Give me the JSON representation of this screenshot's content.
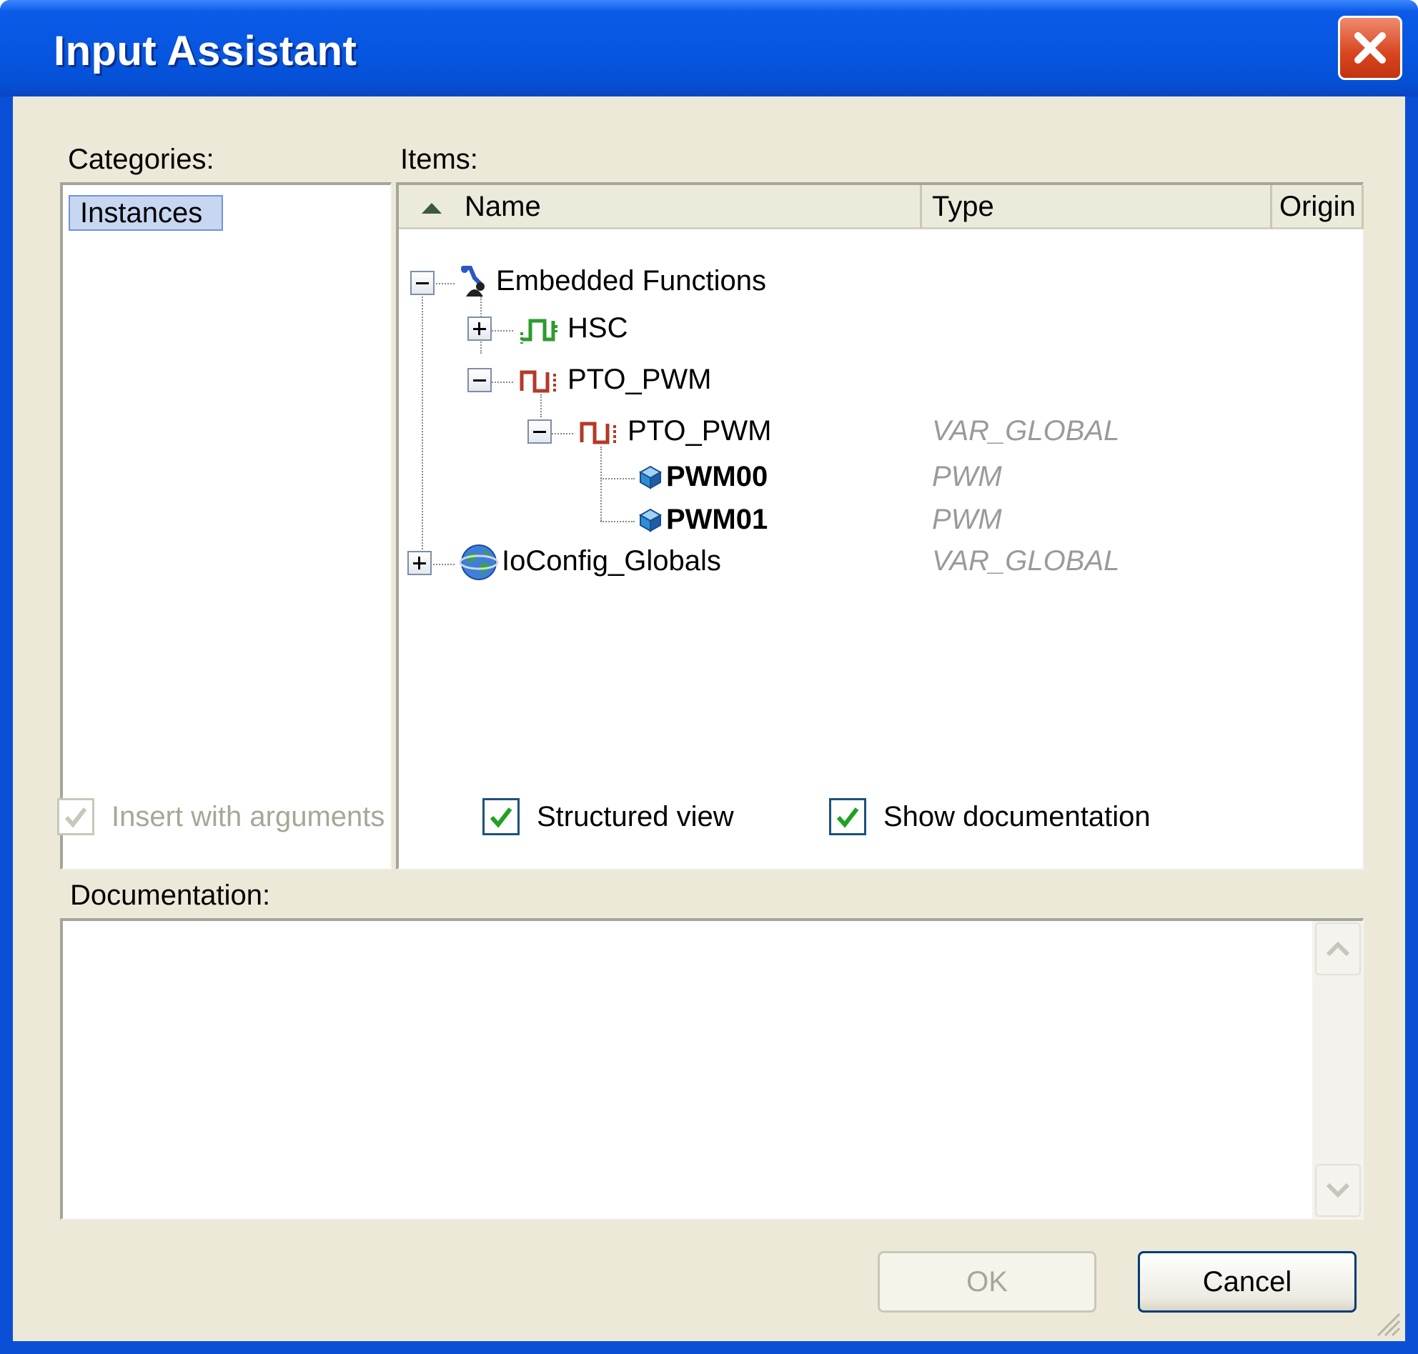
{
  "dialog": {
    "title": "Input Assistant"
  },
  "categories": {
    "label": "Categories:",
    "items": [
      "Instances"
    ]
  },
  "items": {
    "label": "Items:",
    "columns": {
      "name": "Name",
      "type": "Type",
      "origin": "Origin"
    },
    "rows": [
      {
        "name": "Embedded Functions",
        "type": ""
      },
      {
        "name": "HSC",
        "type": ""
      },
      {
        "name": "PTO_PWM",
        "type": ""
      },
      {
        "name": "PTO_PWM",
        "type": "VAR_GLOBAL"
      },
      {
        "name": "PWM00",
        "type": "PWM"
      },
      {
        "name": "PWM01",
        "type": "PWM"
      },
      {
        "name": "IoConfig_Globals",
        "type": "VAR_GLOBAL"
      }
    ]
  },
  "options": {
    "insert_with_arguments": {
      "label": "Insert with arguments",
      "checked": true,
      "enabled": false
    },
    "structured_view": {
      "label": "Structured view",
      "checked": true,
      "enabled": true
    },
    "show_documentation": {
      "label": "Show documentation",
      "checked": true,
      "enabled": true
    }
  },
  "documentation": {
    "label": "Documentation:",
    "text": ""
  },
  "buttons": {
    "ok": "OK",
    "cancel": "Cancel"
  },
  "colors": {
    "titlebar": "#0656e0",
    "client": "#ece9d8",
    "selection": "#c7d6f1",
    "check": "#21a121",
    "type_text": "#9a9a9a"
  }
}
